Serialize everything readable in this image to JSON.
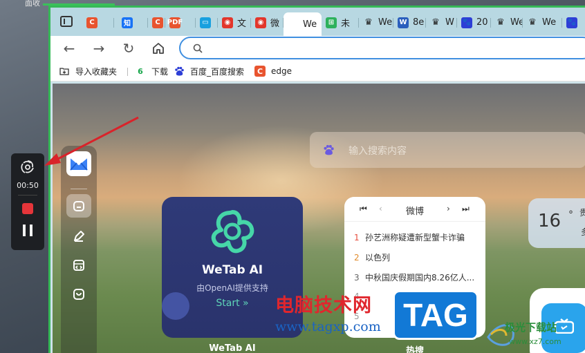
{
  "desktop": {
    "label": "面收"
  },
  "recorder": {
    "time": "00:50"
  },
  "browser": {
    "tabs": [
      {
        "label": "",
        "icon": "c-icon",
        "color": "#e8542f",
        "text": "C"
      },
      {
        "label": "",
        "icon": "zhihu-icon",
        "color": "#1772f6",
        "text": "知"
      },
      {
        "label": "",
        "icon": "c-icon",
        "color": "#e8542f",
        "text": "C"
      },
      {
        "label": "",
        "icon": "pdf-icon",
        "color": "#e8542f",
        "text": "PDF"
      },
      {
        "label": "",
        "icon": "bilibili-icon",
        "color": "#19a0df",
        "text": "▭"
      },
      {
        "label": "文",
        "icon": "weibo-icon",
        "color": "#e2362b",
        "text": "◉"
      },
      {
        "label": "微",
        "icon": "weibo-icon",
        "color": "#e2362b",
        "text": "◉"
      },
      {
        "label": "We",
        "icon": "wetab-icon",
        "color": "#ffffff",
        "text": ""
      },
      {
        "label": "未",
        "icon": "grid-icon",
        "color": "#2db15c",
        "text": "⊞"
      },
      {
        "label": "We",
        "icon": "crown-icon",
        "color": "#222222",
        "text": "♛"
      },
      {
        "label": "8e",
        "icon": "word-icon",
        "color": "#2b5fbd",
        "text": "W"
      },
      {
        "label": "W",
        "icon": "crown-icon",
        "color": "#222222",
        "text": "♛"
      },
      {
        "label": "20",
        "icon": "baidu-icon",
        "color": "#2d3ed6",
        "text": "🐾"
      },
      {
        "label": "We",
        "icon": "crown-icon",
        "color": "#222222",
        "text": "♛"
      },
      {
        "label": "We",
        "icon": "crown-icon",
        "color": "#222222",
        "text": "♛"
      },
      {
        "label": "",
        "icon": "baidu-icon",
        "color": "#2d3ed6",
        "text": "🐾"
      }
    ],
    "bookmarks": [
      {
        "label": "导入收藏夹",
        "icon": "import-icon"
      },
      {
        "label": "下载",
        "icon": "download-six-icon",
        "glyph": "6"
      },
      {
        "label": "百度_百度搜索",
        "icon": "baidu-icon"
      },
      {
        "label": "edge",
        "icon": "c-icon",
        "glyph": "C"
      }
    ]
  },
  "newtab": {
    "search_placeholder": "输入搜索内容",
    "ai_card": {
      "title": "WeTab AI",
      "subtitle": "由OpenAI提供支持",
      "start": "Start »",
      "caption": "WeTab AI"
    },
    "hot_card": {
      "title": "微博",
      "caption": "热搜",
      "items": [
        {
          "rank": "1",
          "text": "孙艺洲称疑遭新型蟹卡诈骗",
          "color": "#e74c3c"
        },
        {
          "rank": "2",
          "text": "以色列",
          "color": "#e08a2b"
        },
        {
          "rank": "3",
          "text": "中秋国庆假期国内8.26亿人...",
          "color": "#666666"
        },
        {
          "rank": "4",
          "text": "",
          "color": "#999999"
        },
        {
          "rank": "5",
          "text": "",
          "color": "#999999"
        }
      ]
    },
    "weather": {
      "temp": "16",
      "unit": "°",
      "city": "贵",
      "extra": "多"
    }
  },
  "watermark": {
    "brand_cn": "电脑技术网",
    "brand_url": "www.tagxp.com",
    "tag": "TAG",
    "jg_name": "极光下载站",
    "jg_url": "www.xz7.com"
  },
  "colors": {
    "accent": "#3f8fe0",
    "window_border": "#35b957",
    "record_stop": "#e5353a",
    "arrow": "#d9232a"
  }
}
